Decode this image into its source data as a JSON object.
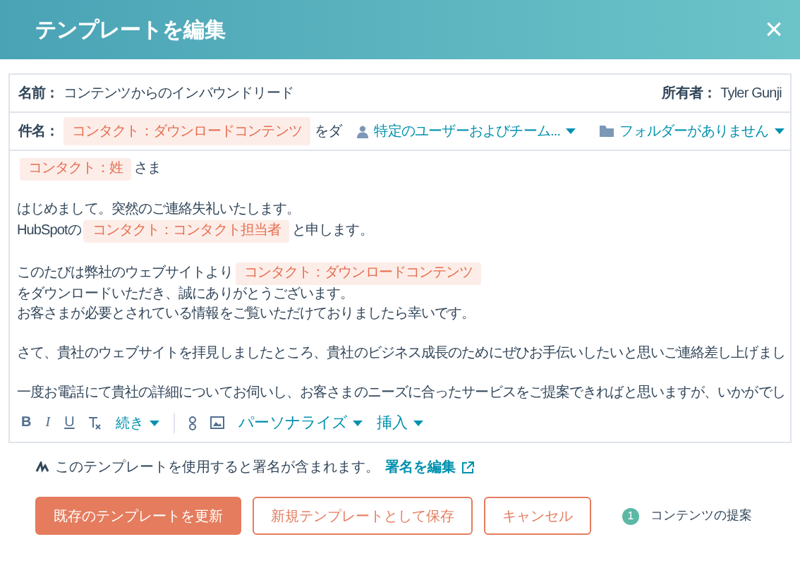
{
  "window": {
    "title": "テンプレートを編集",
    "close": "×"
  },
  "name_row": {
    "label": "名前：",
    "value": "コンテンツからのインバウンドリード",
    "owner_label": "所有者：",
    "owner": "Tyler Gunji"
  },
  "subject_row": {
    "label": "件名：",
    "token": "コンタクト：ダウンロードコンテンツ",
    "suffix": "をダ",
    "sharing": "特定のユーザーおよびチーム...",
    "folder": "フォルダーがありません"
  },
  "body": [
    [
      [
        {
          "kind": "token",
          "text": "コンタクト：姓"
        },
        {
          "kind": "text",
          "text": "さま"
        }
      ]
    ],
    [
      [
        {
          "kind": "text",
          "text": "はじめまして。突然のご連絡失礼いたします。"
        }
      ],
      [
        {
          "kind": "text",
          "text": "HubSpotの"
        },
        {
          "kind": "token",
          "text": "コンタクト：コンタクト担当者"
        },
        {
          "kind": "text",
          "text": "と申します。"
        }
      ]
    ],
    [
      [
        {
          "kind": "text",
          "text": "このたびは弊社のウェブサイトより"
        },
        {
          "kind": "token",
          "text": "コンタクト：ダウンロードコンテンツ"
        }
      ],
      [
        {
          "kind": "text",
          "text": "をダウンロードいただき、誠にありがとうございます。"
        }
      ],
      [
        {
          "kind": "text",
          "text": "お客さまが必要とされている情報をご覧いただけておりましたら幸いです。"
        }
      ]
    ],
    [
      [
        {
          "kind": "text",
          "text": "さて、貴社のウェブサイトを拝見しましたところ、貴社のビジネス成長のためにぜひお手伝いしたいと思いご連絡差し上げまし"
        }
      ]
    ],
    [
      [
        {
          "kind": "text",
          "text": "一度お電話にて貴社の詳細についてお伺いし、お客さまのニーズに合ったサービスをご提案できればと思いますが、いかがでし"
        }
      ]
    ]
  ],
  "toolbar": {
    "bold": "B",
    "italic": "I",
    "underline": "U",
    "more": "続き",
    "personalize": "パーソナライズ",
    "insert": "挿入"
  },
  "signature_note": {
    "text": "このテンプレートを使用すると署名が含まれます。",
    "link": "署名を編集"
  },
  "buttons": [
    {
      "kind": "primary",
      "label": "既存のテンプレートを更新"
    },
    {
      "kind": "secondary",
      "label": "新規テンプレートとして保存"
    },
    {
      "kind": "secondary",
      "label": "キャンセル"
    }
  ],
  "suggestion": {
    "count": "1",
    "label": "コンテンツの提案"
  }
}
